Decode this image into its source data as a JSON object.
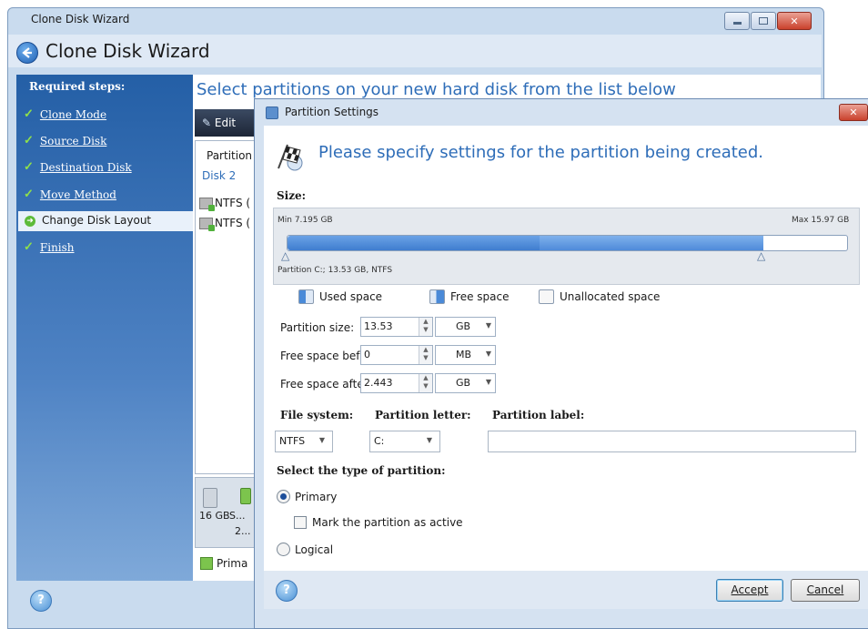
{
  "main_window": {
    "title": "Clone Disk Wizard",
    "heading": "Clone Disk Wizard",
    "content_title": "Select partitions on your new hard disk from the list below"
  },
  "sidebar": {
    "header": "Required steps:",
    "steps": [
      {
        "label": "Clone Mode",
        "done": true
      },
      {
        "label": "Source Disk",
        "done": true
      },
      {
        "label": "Destination Disk",
        "done": true
      },
      {
        "label": "Move Method",
        "done": true
      },
      {
        "label": "Change Disk Layout",
        "current": true
      },
      {
        "label": "Finish",
        "done": true
      }
    ]
  },
  "toolbar": {
    "edit_label": "Edit"
  },
  "partition_list": {
    "column_header": "Partition",
    "disk_label": "Disk 2",
    "rows": [
      "NTFS (",
      "NTFS ("
    ]
  },
  "disk_panel": {
    "size": "16 GB",
    "name": "S...",
    "detail": "2..."
  },
  "legend_main": {
    "primary": "Prima"
  },
  "dialog": {
    "title": "Partition Settings",
    "heading": "Please specify settings for the partition being created.",
    "size_label": "Size:",
    "min_label": "Min 7.195 GB",
    "max_label": "Max 15.97 GB",
    "partition_info": "Partition C:; 13.53 GB, NTFS",
    "slider": {
      "used_fraction": 0.45,
      "free_fraction": 0.4,
      "unallocated_fraction": 0.15
    },
    "legend": {
      "used": "Used space",
      "free": "Free space",
      "unallocated": "Unallocated space"
    },
    "fields": {
      "partition_size": {
        "label": "Partition size:",
        "value": "13.53",
        "unit": "GB"
      },
      "free_before": {
        "label": "Free space before:",
        "value": "0",
        "unit": "MB"
      },
      "free_after": {
        "label": "Free space after:",
        "value": "2.443",
        "unit": "GB"
      }
    },
    "file_system": {
      "label": "File system:",
      "value": "NTFS"
    },
    "partition_letter": {
      "label": "Partition letter:",
      "value": "C:"
    },
    "partition_label": {
      "label": "Partition label:",
      "value": ""
    },
    "type_label": "Select the type of partition:",
    "primary_label": "Primary",
    "active_label": "Mark the partition as active",
    "logical_label": "Logical",
    "accept_label": "Accept",
    "cancel_label": "Cancel"
  },
  "colors": {
    "accent": "#2e6db8",
    "used": "#4a8ad8",
    "free": "#a8c8ef",
    "unallocated": "#ffffff",
    "primary_green": "#7cc44d"
  },
  "icons": {
    "back": "back-arrow-icon",
    "help": "help-icon",
    "flag": "checkered-flag-icon",
    "close": "close-icon"
  }
}
